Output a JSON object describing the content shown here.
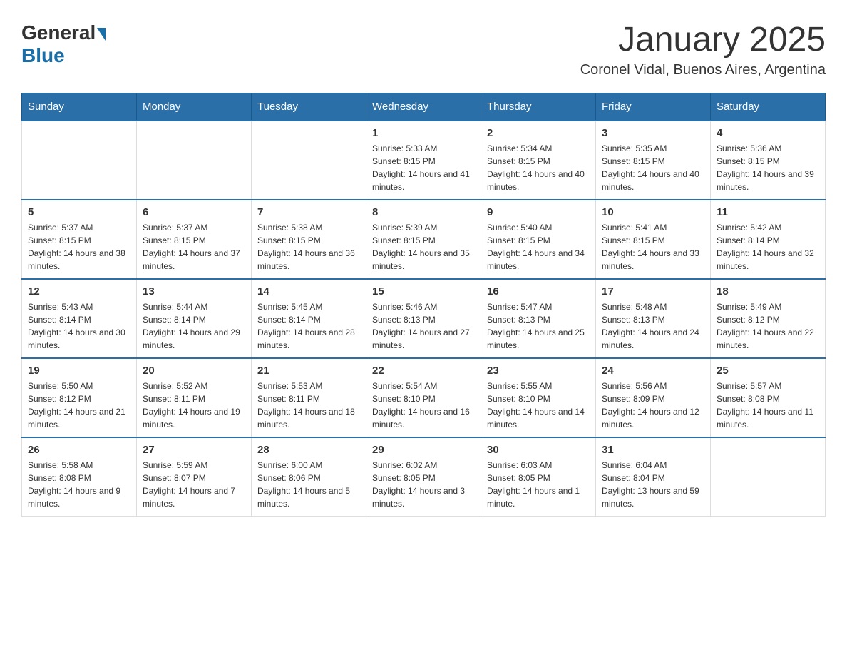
{
  "logo": {
    "general": "General",
    "blue": "Blue"
  },
  "title": "January 2025",
  "subtitle": "Coronel Vidal, Buenos Aires, Argentina",
  "days_of_week": [
    "Sunday",
    "Monday",
    "Tuesday",
    "Wednesday",
    "Thursday",
    "Friday",
    "Saturday"
  ],
  "weeks": [
    [
      {
        "day": "",
        "info": ""
      },
      {
        "day": "",
        "info": ""
      },
      {
        "day": "",
        "info": ""
      },
      {
        "day": "1",
        "info": "Sunrise: 5:33 AM\nSunset: 8:15 PM\nDaylight: 14 hours and 41 minutes."
      },
      {
        "day": "2",
        "info": "Sunrise: 5:34 AM\nSunset: 8:15 PM\nDaylight: 14 hours and 40 minutes."
      },
      {
        "day": "3",
        "info": "Sunrise: 5:35 AM\nSunset: 8:15 PM\nDaylight: 14 hours and 40 minutes."
      },
      {
        "day": "4",
        "info": "Sunrise: 5:36 AM\nSunset: 8:15 PM\nDaylight: 14 hours and 39 minutes."
      }
    ],
    [
      {
        "day": "5",
        "info": "Sunrise: 5:37 AM\nSunset: 8:15 PM\nDaylight: 14 hours and 38 minutes."
      },
      {
        "day": "6",
        "info": "Sunrise: 5:37 AM\nSunset: 8:15 PM\nDaylight: 14 hours and 37 minutes."
      },
      {
        "day": "7",
        "info": "Sunrise: 5:38 AM\nSunset: 8:15 PM\nDaylight: 14 hours and 36 minutes."
      },
      {
        "day": "8",
        "info": "Sunrise: 5:39 AM\nSunset: 8:15 PM\nDaylight: 14 hours and 35 minutes."
      },
      {
        "day": "9",
        "info": "Sunrise: 5:40 AM\nSunset: 8:15 PM\nDaylight: 14 hours and 34 minutes."
      },
      {
        "day": "10",
        "info": "Sunrise: 5:41 AM\nSunset: 8:15 PM\nDaylight: 14 hours and 33 minutes."
      },
      {
        "day": "11",
        "info": "Sunrise: 5:42 AM\nSunset: 8:14 PM\nDaylight: 14 hours and 32 minutes."
      }
    ],
    [
      {
        "day": "12",
        "info": "Sunrise: 5:43 AM\nSunset: 8:14 PM\nDaylight: 14 hours and 30 minutes."
      },
      {
        "day": "13",
        "info": "Sunrise: 5:44 AM\nSunset: 8:14 PM\nDaylight: 14 hours and 29 minutes."
      },
      {
        "day": "14",
        "info": "Sunrise: 5:45 AM\nSunset: 8:14 PM\nDaylight: 14 hours and 28 minutes."
      },
      {
        "day": "15",
        "info": "Sunrise: 5:46 AM\nSunset: 8:13 PM\nDaylight: 14 hours and 27 minutes."
      },
      {
        "day": "16",
        "info": "Sunrise: 5:47 AM\nSunset: 8:13 PM\nDaylight: 14 hours and 25 minutes."
      },
      {
        "day": "17",
        "info": "Sunrise: 5:48 AM\nSunset: 8:13 PM\nDaylight: 14 hours and 24 minutes."
      },
      {
        "day": "18",
        "info": "Sunrise: 5:49 AM\nSunset: 8:12 PM\nDaylight: 14 hours and 22 minutes."
      }
    ],
    [
      {
        "day": "19",
        "info": "Sunrise: 5:50 AM\nSunset: 8:12 PM\nDaylight: 14 hours and 21 minutes."
      },
      {
        "day": "20",
        "info": "Sunrise: 5:52 AM\nSunset: 8:11 PM\nDaylight: 14 hours and 19 minutes."
      },
      {
        "day": "21",
        "info": "Sunrise: 5:53 AM\nSunset: 8:11 PM\nDaylight: 14 hours and 18 minutes."
      },
      {
        "day": "22",
        "info": "Sunrise: 5:54 AM\nSunset: 8:10 PM\nDaylight: 14 hours and 16 minutes."
      },
      {
        "day": "23",
        "info": "Sunrise: 5:55 AM\nSunset: 8:10 PM\nDaylight: 14 hours and 14 minutes."
      },
      {
        "day": "24",
        "info": "Sunrise: 5:56 AM\nSunset: 8:09 PM\nDaylight: 14 hours and 12 minutes."
      },
      {
        "day": "25",
        "info": "Sunrise: 5:57 AM\nSunset: 8:08 PM\nDaylight: 14 hours and 11 minutes."
      }
    ],
    [
      {
        "day": "26",
        "info": "Sunrise: 5:58 AM\nSunset: 8:08 PM\nDaylight: 14 hours and 9 minutes."
      },
      {
        "day": "27",
        "info": "Sunrise: 5:59 AM\nSunset: 8:07 PM\nDaylight: 14 hours and 7 minutes."
      },
      {
        "day": "28",
        "info": "Sunrise: 6:00 AM\nSunset: 8:06 PM\nDaylight: 14 hours and 5 minutes."
      },
      {
        "day": "29",
        "info": "Sunrise: 6:02 AM\nSunset: 8:05 PM\nDaylight: 14 hours and 3 minutes."
      },
      {
        "day": "30",
        "info": "Sunrise: 6:03 AM\nSunset: 8:05 PM\nDaylight: 14 hours and 1 minute."
      },
      {
        "day": "31",
        "info": "Sunrise: 6:04 AM\nSunset: 8:04 PM\nDaylight: 13 hours and 59 minutes."
      },
      {
        "day": "",
        "info": ""
      }
    ]
  ]
}
